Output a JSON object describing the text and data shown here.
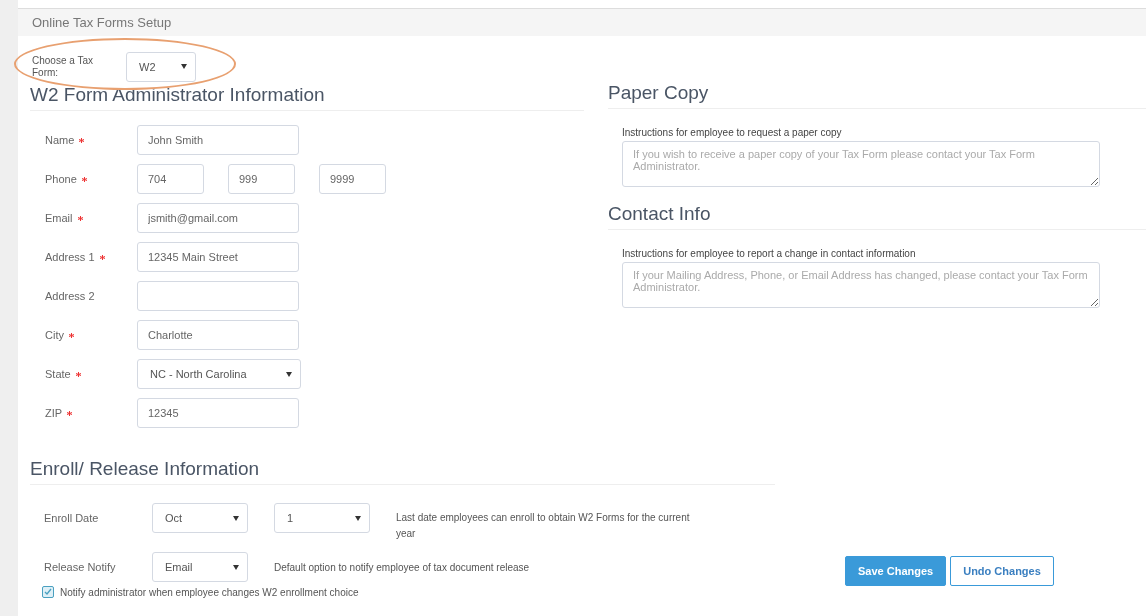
{
  "header": {
    "title": "Online Tax Forms Setup"
  },
  "tax_form": {
    "label": "Choose a Tax Form:",
    "value": "W2",
    "highlighted": true
  },
  "admin": {
    "heading": "W2 Form Administrator Information",
    "fields": [
      {
        "kind": "text",
        "label": "Name",
        "required": true,
        "values": [
          "John Smith"
        ]
      },
      {
        "kind": "phone",
        "label": "Phone",
        "required": true,
        "values": [
          "704",
          "999",
          "9999"
        ]
      },
      {
        "kind": "text",
        "label": "Email",
        "required": true,
        "values": [
          "jsmith@gmail.com"
        ]
      },
      {
        "kind": "text",
        "label": "Address 1",
        "required": true,
        "values": [
          "12345 Main Street"
        ]
      },
      {
        "kind": "text",
        "label": "Address 2",
        "required": false
      },
      {
        "kind": "text",
        "label": "City",
        "required": true,
        "values": [
          "Charlotte"
        ]
      },
      {
        "kind": "select",
        "label": "State",
        "required": true,
        "values": [
          "NC - North Carolina"
        ]
      },
      {
        "kind": "text",
        "label": "ZIP",
        "required": true,
        "values": [
          "12345"
        ]
      }
    ]
  },
  "paper_copy": {
    "heading": "Paper Copy",
    "label": "Instructions for employee to request a paper copy",
    "placeholder": "If you wish to receive a paper copy of your Tax Form please contact your Tax Form Administrator."
  },
  "contact_info": {
    "heading": "Contact Info",
    "label": "Instructions for employee to report a change in contact information",
    "placeholder": "If your Mailing Address, Phone, or Email Address has changed, please contact your Tax Form Administrator."
  },
  "enroll": {
    "heading": "Enroll/ Release Information",
    "rows": [
      {
        "label": "Enroll Date",
        "selects": [
          "Oct",
          "1"
        ],
        "note": "Last date employees can enroll to obtain W2 Forms for the current year"
      },
      {
        "label": "Release Notify",
        "selects": [
          "Email"
        ],
        "note": "Default option to notify employee of tax document release"
      }
    ],
    "notify": {
      "label": "Notify administrator when employee changes W2 enrollment choice",
      "checked": true
    }
  },
  "buttons": [
    {
      "label": "Save Changes",
      "kind": "primary"
    },
    {
      "label": "Undo Changes",
      "kind": "secondary"
    }
  ]
}
